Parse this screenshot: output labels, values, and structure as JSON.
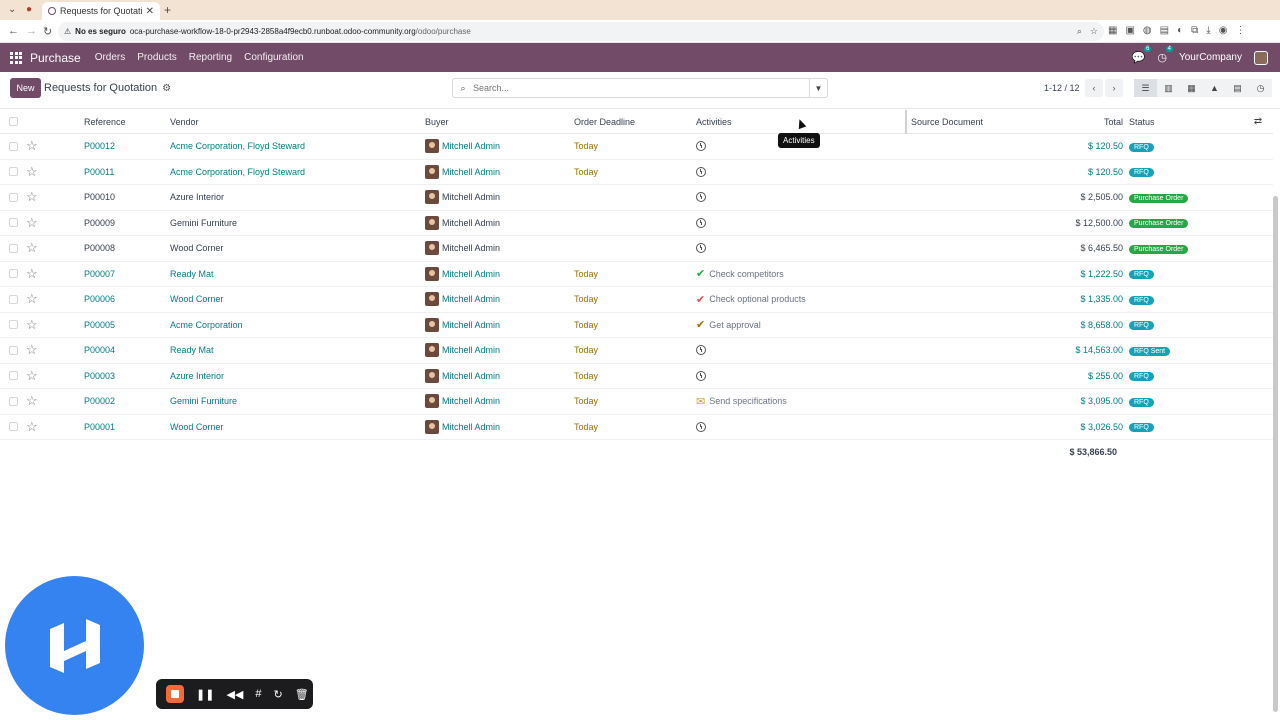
{
  "browser": {
    "tab_title": "Requests for Quotatio",
    "omnibox_warning": "No es seguro",
    "url_host": "oca-purchase-workflow-18-0-pr2943-2858a4f9ecb0.runboat.odoo-community.org",
    "url_path": "/odoo/purchase"
  },
  "navbar": {
    "app": "Purchase",
    "menu": [
      "Orders",
      "Products",
      "Reporting",
      "Configuration"
    ],
    "messages_count": "6",
    "activities_count": "4",
    "company": "YourCompany"
  },
  "control_panel": {
    "new_label": "New",
    "title": "Requests for Quotation",
    "search_placeholder": "Search...",
    "pager": "1-12 / 12"
  },
  "table": {
    "headers": [
      "Reference",
      "Vendor",
      "Buyer",
      "Order Deadline",
      "Activities",
      "Source Document",
      "Total",
      "Status"
    ],
    "rows": [
      {
        "ref": "P00012",
        "vendor": "Acme Corporation, Floyd Steward",
        "buyer": "Mitchell Admin",
        "deadline": "Today",
        "activity": "",
        "activity_icon": "clock",
        "total": "$ 120.50",
        "status": "RFQ",
        "status_kind": "rfq",
        "linked": true
      },
      {
        "ref": "P00011",
        "vendor": "Acme Corporation, Floyd Steward",
        "buyer": "Mitchell Admin",
        "deadline": "Today",
        "activity": "",
        "activity_icon": "clock",
        "total": "$ 120.50",
        "status": "RFQ",
        "status_kind": "rfq",
        "linked": true
      },
      {
        "ref": "P00010",
        "vendor": "Azure Interior",
        "buyer": "Mitchell Admin",
        "deadline": "",
        "activity": "",
        "activity_icon": "clock",
        "total": "$ 2,505.00",
        "status": "Purchase Order",
        "status_kind": "po",
        "linked": false
      },
      {
        "ref": "P00009",
        "vendor": "Gemini Furniture",
        "buyer": "Mitchell Admin",
        "deadline": "",
        "activity": "",
        "activity_icon": "clock",
        "total": "$ 12,500.00",
        "status": "Purchase Order",
        "status_kind": "po",
        "linked": false
      },
      {
        "ref": "P00008",
        "vendor": "Wood Corner",
        "buyer": "Mitchell Admin",
        "deadline": "",
        "activity": "",
        "activity_icon": "clock",
        "total": "$ 6,465.50",
        "status": "Purchase Order",
        "status_kind": "po",
        "linked": false
      },
      {
        "ref": "P00007",
        "vendor": "Ready Mat",
        "buyer": "Mitchell Admin",
        "deadline": "Today",
        "activity": "Check competitors",
        "activity_icon": "check-green",
        "total": "$ 1,222.50",
        "status": "RFQ",
        "status_kind": "rfq",
        "linked": true
      },
      {
        "ref": "P00006",
        "vendor": "Wood Corner",
        "buyer": "Mitchell Admin",
        "deadline": "Today",
        "activity": "Check optional products",
        "activity_icon": "check-red",
        "total": "$ 1,335.00",
        "status": "RFQ",
        "status_kind": "rfq",
        "linked": true
      },
      {
        "ref": "P00005",
        "vendor": "Acme Corporation",
        "buyer": "Mitchell Admin",
        "deadline": "Today",
        "activity": "Get approval",
        "activity_icon": "check-warn",
        "total": "$ 8,658.00",
        "status": "RFQ",
        "status_kind": "rfq",
        "linked": true
      },
      {
        "ref": "P00004",
        "vendor": "Ready Mat",
        "buyer": "Mitchell Admin",
        "deadline": "Today",
        "activity": "",
        "activity_icon": "clock",
        "total": "$ 14,563.00",
        "status": "RFQ Sent",
        "status_kind": "sent",
        "linked": true
      },
      {
        "ref": "P00003",
        "vendor": "Azure Interior",
        "buyer": "Mitchell Admin",
        "deadline": "Today",
        "activity": "",
        "activity_icon": "clock",
        "total": "$ 255.00",
        "status": "RFQ",
        "status_kind": "rfq",
        "linked": true
      },
      {
        "ref": "P00002",
        "vendor": "Gemini Furniture",
        "buyer": "Mitchell Admin",
        "deadline": "Today",
        "activity": "Send specifications",
        "activity_icon": "mail",
        "total": "$ 3,095.00",
        "status": "RFQ",
        "status_kind": "rfq",
        "linked": true
      },
      {
        "ref": "P00001",
        "vendor": "Wood Corner",
        "buyer": "Mitchell Admin",
        "deadline": "Today",
        "activity": "",
        "activity_icon": "clock",
        "total": "$ 3,026.50",
        "status": "RFQ",
        "status_kind": "rfq",
        "linked": true
      }
    ],
    "grand_total": "$ 53,866.50"
  },
  "tooltip": "Activities",
  "colors": {
    "brand": "#714b67",
    "link": "#017e84",
    "today": "#a16d04",
    "rfq": "#17a2b8",
    "po": "#28a745"
  }
}
